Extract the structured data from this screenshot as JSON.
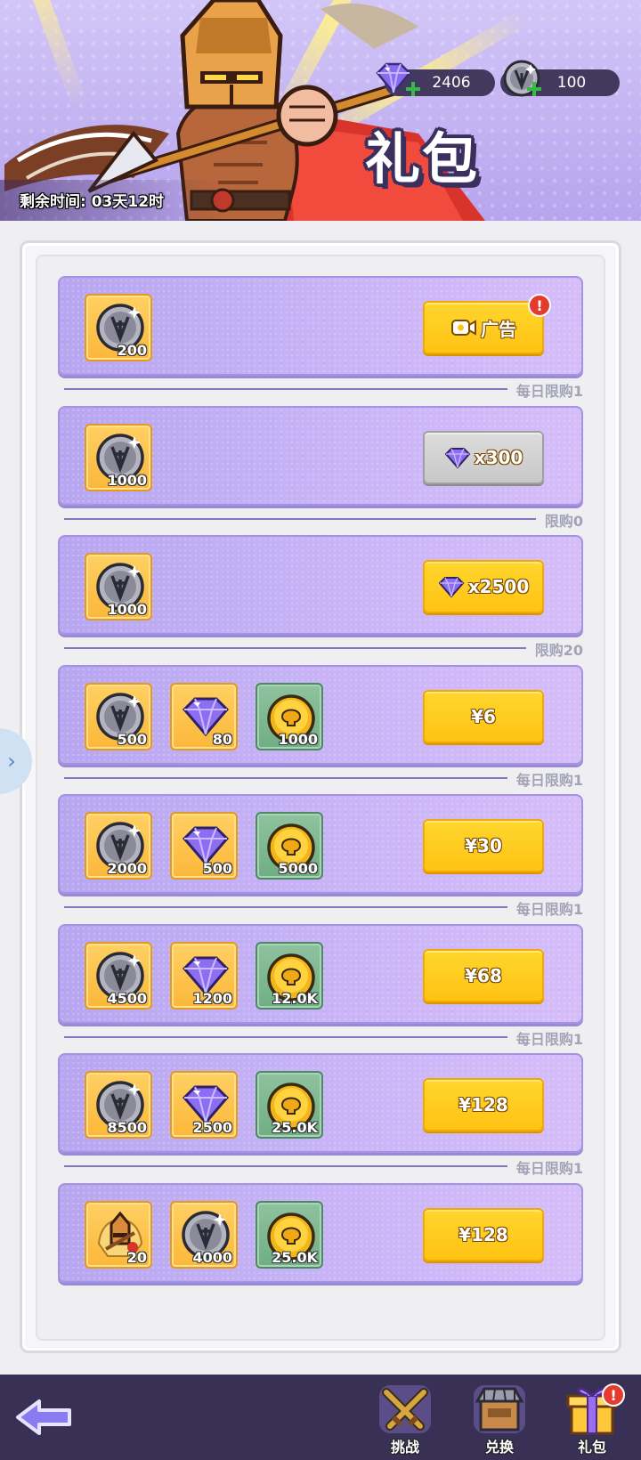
{
  "header": {
    "title": "礼包",
    "timer_text": "剩余时间: 03天12时",
    "currencies": [
      {
        "name": "gem",
        "value": "2406"
      },
      {
        "name": "silver-coin",
        "value": "100"
      }
    ]
  },
  "offers": [
    {
      "items": [
        {
          "icon": "silver-coin-icon",
          "qty": "200",
          "bg": "orange"
        }
      ],
      "button": {
        "type": "ad",
        "label": "广告",
        "badge": "!"
      },
      "limit": "每日限购1"
    },
    {
      "items": [
        {
          "icon": "silver-coin-icon",
          "qty": "1000",
          "bg": "orange"
        }
      ],
      "button": {
        "type": "gem",
        "label": "x300",
        "disabled": true
      },
      "limit": "限购0"
    },
    {
      "items": [
        {
          "icon": "silver-coin-icon",
          "qty": "1000",
          "bg": "orange"
        }
      ],
      "button": {
        "type": "gem",
        "label": "x2500"
      },
      "limit": "限购20"
    },
    {
      "items": [
        {
          "icon": "silver-coin-icon",
          "qty": "500",
          "bg": "orange"
        },
        {
          "icon": "gem-icon",
          "qty": "80",
          "bg": "orange"
        },
        {
          "icon": "gold-coin-icon",
          "qty": "1000",
          "bg": "green"
        }
      ],
      "button": {
        "type": "price",
        "label": "¥6"
      },
      "limit": "每日限购1"
    },
    {
      "items": [
        {
          "icon": "silver-coin-icon",
          "qty": "2000",
          "bg": "orange"
        },
        {
          "icon": "gem-icon",
          "qty": "500",
          "bg": "orange"
        },
        {
          "icon": "gold-coin-icon",
          "qty": "5000",
          "bg": "green"
        }
      ],
      "button": {
        "type": "price",
        "label": "¥30"
      },
      "limit": "每日限购1"
    },
    {
      "items": [
        {
          "icon": "silver-coin-icon",
          "qty": "4500",
          "bg": "orange"
        },
        {
          "icon": "gem-icon",
          "qty": "1200",
          "bg": "orange"
        },
        {
          "icon": "gold-coin-icon",
          "qty": "12.0K",
          "bg": "green"
        }
      ],
      "button": {
        "type": "price",
        "label": "¥68"
      },
      "limit": "每日限购1"
    },
    {
      "items": [
        {
          "icon": "silver-coin-icon",
          "qty": "8500",
          "bg": "orange"
        },
        {
          "icon": "gem-icon",
          "qty": "2500",
          "bg": "orange"
        },
        {
          "icon": "gold-coin-icon",
          "qty": "25.0K",
          "bg": "green"
        }
      ],
      "button": {
        "type": "price",
        "label": "¥128"
      },
      "limit": "每日限购1"
    },
    {
      "items": [
        {
          "icon": "hero-card-icon",
          "qty": "20",
          "bg": "orange"
        },
        {
          "icon": "silver-coin-icon",
          "qty": "4000",
          "bg": "orange"
        },
        {
          "icon": "gold-coin-icon",
          "qty": "25.0K",
          "bg": "green"
        }
      ],
      "button": {
        "type": "price",
        "label": "¥128"
      },
      "limit": ""
    }
  ],
  "bottom_nav": {
    "back_icon": "back-arrow-icon",
    "items": [
      {
        "label": "挑战",
        "icon": "crossed-swords-icon"
      },
      {
        "label": "兑换",
        "icon": "shop-icon"
      },
      {
        "label": "礼包",
        "icon": "gift-box-icon",
        "badge": "!"
      }
    ]
  },
  "colors": {
    "accent_yellow": "#ffc313",
    "card_purple": "#c9b4f7",
    "bar_dark": "#393055",
    "badge_red": "#e53a2e"
  }
}
